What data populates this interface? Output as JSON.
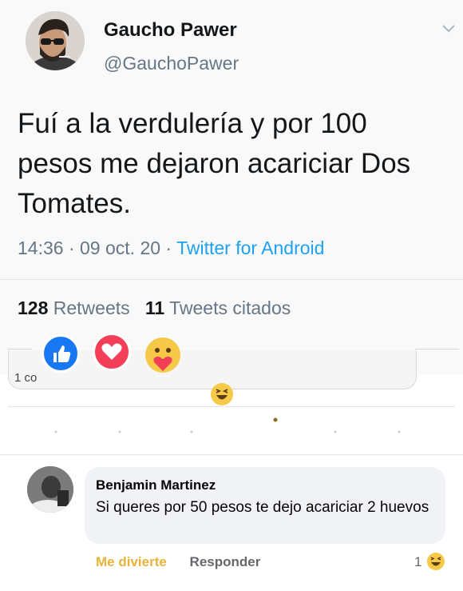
{
  "tweet": {
    "display_name": "Gaucho Pawer",
    "handle": "@GauchoPawer",
    "text": "Fuí a la verdulería y por 100 pesos me dejaron acariciar Dos Tomates.",
    "time": "14:36",
    "date": "09 oct. 20",
    "source": "Twitter for Android",
    "separator": " · ",
    "retweets_count": "128",
    "retweets_label": "Retweets",
    "quotes_count": "11",
    "quotes_label": "Tweets citados"
  },
  "reactions_bar": {
    "cut_text": "1 co",
    "reactions": [
      "like-icon",
      "love-icon",
      "care-icon"
    ],
    "extra_reaction": "haha-icon"
  },
  "comment": {
    "author": "Benjamin Martinez",
    "text": "Si queres por 50 pesos te dejo acariciar 2 huevos",
    "action_reaction": "Me divierte",
    "action_reply": "Responder",
    "reaction_count": "1",
    "reaction_icon": "haha-icon"
  },
  "colors": {
    "twitter_blue": "#1da1f2",
    "secondary_text": "#657786",
    "like_blue": "#1877f2",
    "love_red": "#f33e58",
    "haha_yellow": "#f7c948"
  }
}
